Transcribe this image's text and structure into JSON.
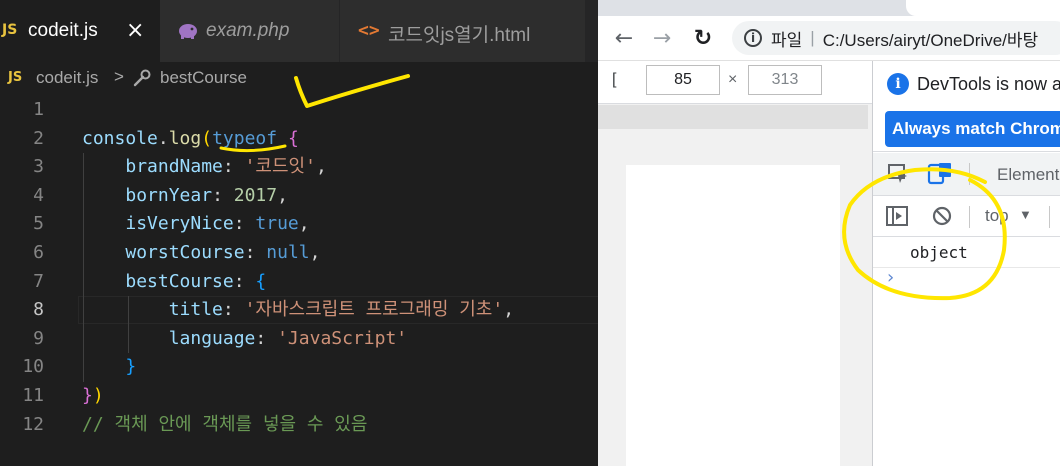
{
  "editor": {
    "tabs": [
      {
        "badge": "JS",
        "label": "codeit.js",
        "close": "×"
      },
      {
        "label": "exam.php"
      },
      {
        "icon_text": "<>",
        "label": "코드잇js열기.html"
      }
    ],
    "breadcrumb": {
      "badge": "JS",
      "file": "codeit.js",
      "separator": ">",
      "symbol": "bestCourse"
    },
    "active_line": 8,
    "code_lines": [
      {
        "n": "1",
        "tokens": []
      },
      {
        "n": "2",
        "tokens": [
          {
            "c": "t-var",
            "t": "console"
          },
          {
            "c": "t-p",
            "t": "."
          },
          {
            "c": "t-fn",
            "t": "log"
          },
          {
            "c": "t-b1",
            "t": "("
          },
          {
            "c": "t-kw",
            "t": "typeof"
          },
          {
            "c": "t-p",
            "t": " "
          },
          {
            "c": "t-b2",
            "t": "{"
          }
        ]
      },
      {
        "n": "3",
        "tokens": [
          {
            "c": "t-p",
            "t": "    "
          },
          {
            "c": "t-var",
            "t": "brandName"
          },
          {
            "c": "t-p",
            "t": ": "
          },
          {
            "c": "t-str",
            "t": "'코드잇'"
          },
          {
            "c": "t-p",
            "t": ","
          }
        ]
      },
      {
        "n": "4",
        "tokens": [
          {
            "c": "t-p",
            "t": "    "
          },
          {
            "c": "t-var",
            "t": "bornYear"
          },
          {
            "c": "t-p",
            "t": ": "
          },
          {
            "c": "t-num",
            "t": "2017"
          },
          {
            "c": "t-p",
            "t": ","
          }
        ]
      },
      {
        "n": "5",
        "tokens": [
          {
            "c": "t-p",
            "t": "    "
          },
          {
            "c": "t-var",
            "t": "isVeryNice"
          },
          {
            "c": "t-p",
            "t": ": "
          },
          {
            "c": "t-kw",
            "t": "true"
          },
          {
            "c": "t-p",
            "t": ","
          }
        ]
      },
      {
        "n": "6",
        "tokens": [
          {
            "c": "t-p",
            "t": "    "
          },
          {
            "c": "t-var",
            "t": "worstCourse"
          },
          {
            "c": "t-p",
            "t": ": "
          },
          {
            "c": "t-kw",
            "t": "null"
          },
          {
            "c": "t-p",
            "t": ","
          }
        ]
      },
      {
        "n": "7",
        "tokens": [
          {
            "c": "t-p",
            "t": "    "
          },
          {
            "c": "t-var",
            "t": "bestCourse"
          },
          {
            "c": "t-p",
            "t": ": "
          },
          {
            "c": "t-b3",
            "t": "{"
          }
        ]
      },
      {
        "n": "8",
        "tokens": [
          {
            "c": "t-p",
            "t": "        "
          },
          {
            "c": "t-var",
            "t": "title"
          },
          {
            "c": "t-p",
            "t": ": "
          },
          {
            "c": "t-str",
            "t": "'자바스크립트 프로그래밍 기초'"
          },
          {
            "c": "t-p",
            "t": ","
          }
        ]
      },
      {
        "n": "9",
        "tokens": [
          {
            "c": "t-p",
            "t": "        "
          },
          {
            "c": "t-var",
            "t": "language"
          },
          {
            "c": "t-p",
            "t": ": "
          },
          {
            "c": "t-str",
            "t": "'JavaScript'"
          }
        ]
      },
      {
        "n": "10",
        "tokens": [
          {
            "c": "t-p",
            "t": "    "
          },
          {
            "c": "t-b3",
            "t": "}"
          }
        ]
      },
      {
        "n": "11",
        "tokens": [
          {
            "c": "t-b2",
            "t": "}"
          },
          {
            "c": "t-b1",
            "t": ")"
          }
        ]
      },
      {
        "n": "12",
        "tokens": [
          {
            "c": "t-cm",
            "t": "// 객체 안에 객체를 넣을 수 있음"
          }
        ]
      }
    ]
  },
  "browser": {
    "nav": {
      "back": "←",
      "forward": "→",
      "reload": "↻"
    },
    "address": {
      "info": "i",
      "label": "파일",
      "separator": "|",
      "url": "C:/Users/airyt/OneDrive/바탕"
    },
    "device_toolbar": {
      "device_indicator": "[",
      "width": "85",
      "times": "×",
      "height_placeholder": "313"
    },
    "devtools": {
      "notice_icon": "i",
      "notice": "DevTools is now a",
      "notice_button": "Always match Chrom",
      "elements_tab": "Element",
      "context": "top",
      "context_arrow": "▼",
      "console_output": "object",
      "prompt": "›"
    }
  },
  "colors": {
    "annotation": "#ffe600",
    "editor_bg": "#1e1e1e",
    "accent_blue": "#1a73e8"
  }
}
